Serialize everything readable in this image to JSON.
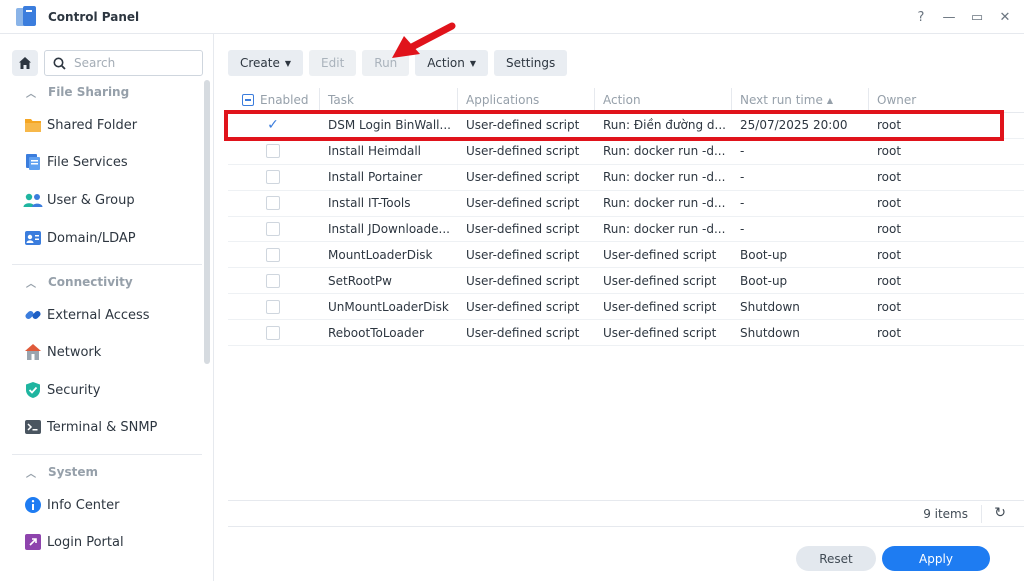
{
  "window": {
    "title": "Control Panel",
    "controls": {
      "help": "?",
      "minimize": "—",
      "maximize": "▭",
      "close": "✕"
    }
  },
  "sidebar": {
    "search_placeholder": "Search",
    "sections": [
      {
        "label": "File Sharing",
        "items": [
          {
            "label": "Shared Folder",
            "icon": "folder-icon"
          },
          {
            "label": "File Services",
            "icon": "file-services-icon"
          },
          {
            "label": "User & Group",
            "icon": "users-icon"
          },
          {
            "label": "Domain/LDAP",
            "icon": "domain-icon"
          }
        ]
      },
      {
        "label": "Connectivity",
        "items": [
          {
            "label": "External Access",
            "icon": "link-icon"
          },
          {
            "label": "Network",
            "icon": "house-icon"
          },
          {
            "label": "Security",
            "icon": "shield-icon"
          },
          {
            "label": "Terminal & SNMP",
            "icon": "terminal-icon"
          }
        ]
      },
      {
        "label": "System",
        "items": [
          {
            "label": "Info Center",
            "icon": "info-icon"
          },
          {
            "label": "Login Portal",
            "icon": "portal-icon"
          }
        ]
      }
    ]
  },
  "toolbar": {
    "create": "Create",
    "edit": "Edit",
    "run": "Run",
    "action": "Action",
    "settings": "Settings"
  },
  "table": {
    "columns": {
      "enabled": "Enabled",
      "task": "Task",
      "applications": "Applications",
      "action": "Action",
      "next_run": "Next run time",
      "owner": "Owner"
    },
    "rows": [
      {
        "enabled": true,
        "task": "DSM Login BinWall...",
        "app": "User-defined script",
        "action": "Run: Điền đường d...",
        "next": "25/07/2025 20:00",
        "owner": "root"
      },
      {
        "enabled": false,
        "task": "Install Heimdall",
        "app": "User-defined script",
        "action": "Run: docker run -d...",
        "next": "-",
        "owner": "root"
      },
      {
        "enabled": false,
        "task": "Install Portainer",
        "app": "User-defined script",
        "action": "Run: docker run -d...",
        "next": "-",
        "owner": "root"
      },
      {
        "enabled": false,
        "task": "Install IT-Tools",
        "app": "User-defined script",
        "action": "Run: docker run -d...",
        "next": "-",
        "owner": "root"
      },
      {
        "enabled": false,
        "task": "Install JDownloade...",
        "app": "User-defined script",
        "action": "Run: docker run -d...",
        "next": "-",
        "owner": "root"
      },
      {
        "enabled": false,
        "task": "MountLoaderDisk",
        "app": "User-defined script",
        "action": "User-defined script",
        "next": "Boot-up",
        "owner": "root"
      },
      {
        "enabled": false,
        "task": "SetRootPw",
        "app": "User-defined script",
        "action": "User-defined script",
        "next": "Boot-up",
        "owner": "root"
      },
      {
        "enabled": false,
        "task": "UnMountLoaderDisk",
        "app": "User-defined script",
        "action": "User-defined script",
        "next": "Shutdown",
        "owner": "root"
      },
      {
        "enabled": false,
        "task": "RebootToLoader",
        "app": "User-defined script",
        "action": "User-defined script",
        "next": "Shutdown",
        "owner": "root"
      }
    ],
    "item_count": "9 items"
  },
  "footer": {
    "reset": "Reset",
    "apply": "Apply"
  },
  "colors": {
    "accent": "#1e7cf2",
    "highlight": "#e0131b"
  }
}
